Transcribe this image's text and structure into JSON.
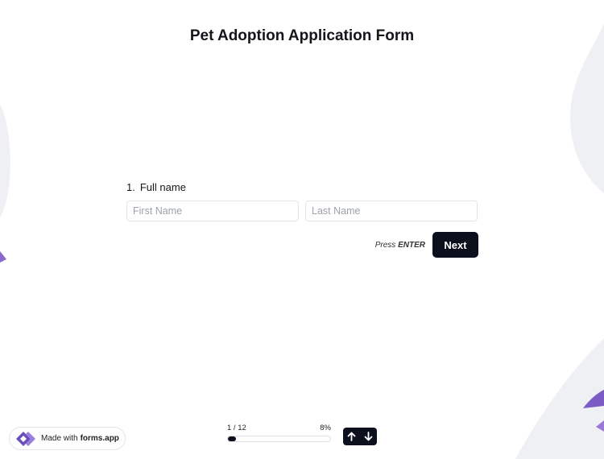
{
  "form": {
    "title": "Pet Adoption Application Form"
  },
  "question": {
    "number": "1.",
    "label": "Full name",
    "first_placeholder": "First Name",
    "last_placeholder": "Last Name"
  },
  "actions": {
    "hint_prefix": "Press",
    "hint_key": "ENTER",
    "next_label": "Next"
  },
  "progress": {
    "counter": "1 / 12",
    "percent_label": "8%",
    "fraction": 0.08
  },
  "badge": {
    "prefix": "Made with",
    "brand": "forms.app"
  },
  "icons": {
    "up": "arrow-up-icon",
    "down": "arrow-down-icon",
    "logo": "forms-app-logo-icon"
  },
  "colors": {
    "primary": "#0c0f1c",
    "background_shape": "#eef0f4",
    "accent_purple": "#7b5bc4"
  }
}
